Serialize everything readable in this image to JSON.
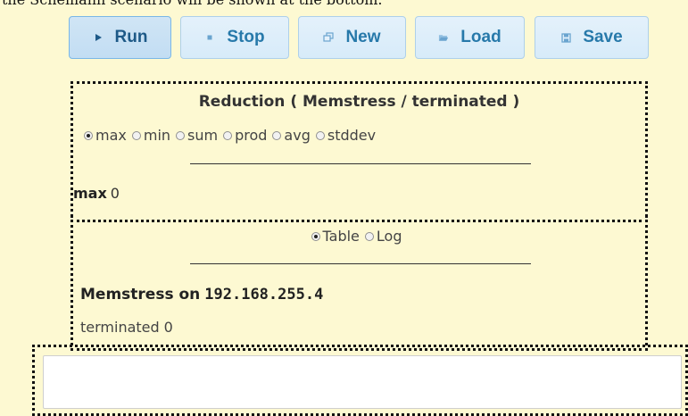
{
  "intro_text": "the Schemann scenario will be shown at the bottom.",
  "toolbar": {
    "buttons": [
      {
        "label": "Run",
        "icon": "play-icon"
      },
      {
        "label": "Stop",
        "icon": "stop-icon"
      },
      {
        "label": "New",
        "icon": "new-window-icon"
      },
      {
        "label": "Load",
        "icon": "folder-open-icon"
      },
      {
        "label": "Save",
        "icon": "save-icon"
      }
    ]
  },
  "reduction": {
    "title": "Reduction ( Memstress / terminated )",
    "options": [
      "max",
      "min",
      "sum",
      "prod",
      "avg",
      "stddev"
    ],
    "selected": "max",
    "result_label": "max",
    "result_value": "0"
  },
  "view": {
    "options": [
      "Table",
      "Log"
    ],
    "selected": "Table",
    "host_prefix": "Memstress on",
    "host_ip": "192.168.255.4",
    "stat_label": "terminated",
    "stat_value": "0"
  },
  "colors": {
    "page_background": "#fdf9d2",
    "button_background": "#dfeffc",
    "button_text": "#2779aa",
    "button_border": "#aed0ea"
  }
}
